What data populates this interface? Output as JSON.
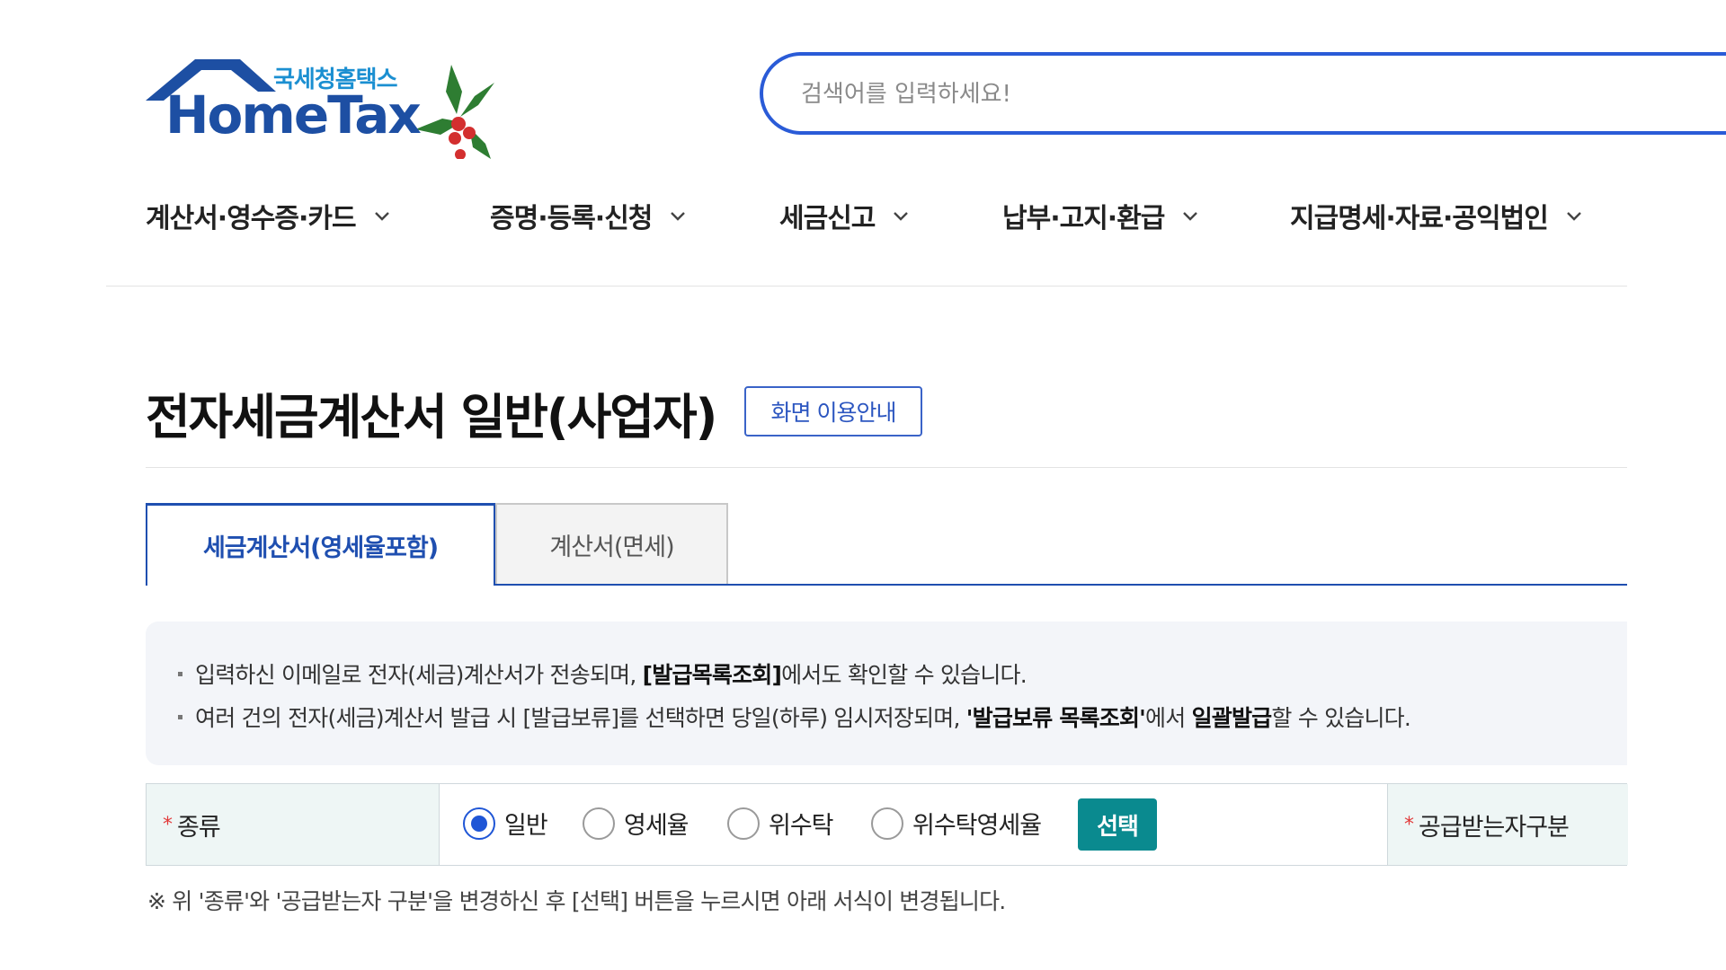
{
  "header": {
    "logo_sub": "국세청홈택스",
    "logo_main": "HomeTax",
    "search_placeholder": "검색어를 입력하세요!"
  },
  "gnb": {
    "items": [
      {
        "label": "계산서·영수증·카드"
      },
      {
        "label": "증명·등록·신청"
      },
      {
        "label": "세금신고"
      },
      {
        "label": "납부·고지·환급"
      },
      {
        "label": "지급명세·자료·공익법인"
      }
    ]
  },
  "page": {
    "title": "전자세금계산서 일반(사업자)",
    "guide_button": "화면 이용안내"
  },
  "tabs": [
    {
      "label": "세금계산서(영세율포함)",
      "active": true
    },
    {
      "label": "계산서(면세)",
      "active": false
    }
  ],
  "notice": {
    "line1_pre": "입력하신 이메일로 전자(세금)계산서가 전송되며, ",
    "line1_bold": "[발급목록조회]",
    "line1_post": "에서도 확인할 수 있습니다.",
    "line2_pre": "여러 건의 전자(세금)계산서 발급 시 [발급보류]를 선택하면 당일(하루) 임시저장되며, ",
    "line2_bold1": "'발급보류 목록조회'",
    "line2_mid": "에서 ",
    "line2_bold2": "일괄발급",
    "line2_post": "할 수 있습니다."
  },
  "form": {
    "required_mark": "*",
    "type_label": "종류",
    "radios": [
      {
        "label": "일반",
        "checked": true
      },
      {
        "label": "영세율",
        "checked": false
      },
      {
        "label": "위수탁",
        "checked": false
      },
      {
        "label": "위수탁영세율",
        "checked": false
      }
    ],
    "select_button": "선택",
    "recipient_label": "공급받는자구분"
  },
  "footnote": "※ 위 '종류'와 '공급받는자 구분'을 변경하신 후 [선택] 버튼을 누르시면 아래 서식이 변경됩니다.",
  "colors": {
    "primary_blue": "#1f4fb0",
    "search_border": "#2a5bd7",
    "teal_button": "#0a8a8f",
    "required_red": "#e23a3a",
    "notice_bg": "#f3f5f9",
    "form_header_bg": "#eef6f5"
  }
}
